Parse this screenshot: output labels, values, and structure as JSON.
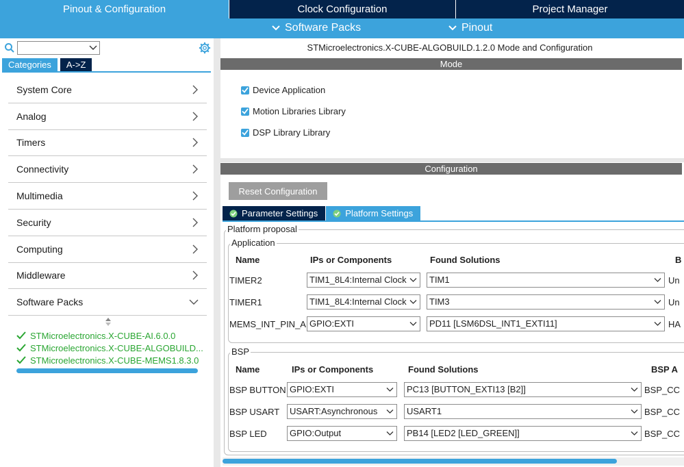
{
  "top_tabs": {
    "pinout": "Pinout & Configuration",
    "clock": "Clock Configuration",
    "project": "Project Manager"
  },
  "sub_menu": {
    "software_packs": "Software Packs",
    "pinout": "Pinout"
  },
  "left": {
    "search_value": "",
    "tabs": {
      "categories": "Categories",
      "az": "A->Z"
    },
    "categories": [
      {
        "label": "System Core"
      },
      {
        "label": "Analog"
      },
      {
        "label": "Timers"
      },
      {
        "label": "Connectivity"
      },
      {
        "label": "Multimedia"
      },
      {
        "label": "Security"
      },
      {
        "label": "Computing"
      },
      {
        "label": "Middleware"
      },
      {
        "label": "Software Packs",
        "expanded": true
      }
    ],
    "packs": [
      "STMicroelectronics.X-CUBE-AI.6.0.0",
      "STMicroelectronics.X-CUBE-ALGOBUILD...",
      "STMicroelectronics.X-CUBE-MEMS1.8.3.0"
    ]
  },
  "right": {
    "title": "STMicroelectronics.X-CUBE-ALGOBUILD.1.2.0 Mode and Configuration",
    "mode_header": "Mode",
    "mode_items": [
      {
        "label": "Device Application",
        "checked": true
      },
      {
        "label": "Motion Libraries Library",
        "checked": true
      },
      {
        "label": "DSP Library Library",
        "checked": true
      }
    ],
    "config_header": "Configuration",
    "reset_button": "Reset Configuration",
    "param_tabs": {
      "parameter": "Parameter Settings",
      "platform": "Platform Settings"
    },
    "platform_proposal": "Platform proposal",
    "application": {
      "legend": "Application",
      "headers": {
        "name": "Name",
        "ips": "IPs or Components",
        "found": "Found Solutions",
        "extra": "B"
      },
      "rows": [
        {
          "name": "TIMER2",
          "ip": "TIM1_8L4:Internal Clock",
          "found": "TIM1",
          "extra": "Un"
        },
        {
          "name": "TIMER1",
          "ip": "TIM1_8L4:Internal Clock",
          "found": "TIM3",
          "extra": "Un"
        },
        {
          "name": "MEMS_INT_PIN_A",
          "ip": "GPIO:EXTI",
          "found": "PD11 [LSM6DSL_INT1_EXTI11]",
          "extra": "HA"
        }
      ]
    },
    "bsp": {
      "legend": "BSP",
      "headers": {
        "name": "Name",
        "ips": "IPs or Components",
        "found": "Found Solutions",
        "extra": "BSP A"
      },
      "rows": [
        {
          "name": "BSP BUTTON",
          "ip": "GPIO:EXTI",
          "found": "PC13 [BUTTON_EXTI13 [B2]]",
          "extra": "BSP_CC"
        },
        {
          "name": "BSP USART",
          "ip": "USART:Asynchronous",
          "found": "USART1",
          "extra": "BSP_CC"
        },
        {
          "name": "BSP LED",
          "ip": "GPIO:Output",
          "found": "PB14 [LED2 [LED_GREEN]]",
          "extra": "BSP_CC"
        }
      ]
    }
  },
  "colors": {
    "accent": "#3ca3dc",
    "dark_navy": "#03234b",
    "header_gray": "#6b6b6b",
    "pack_green": "#2aa632"
  }
}
